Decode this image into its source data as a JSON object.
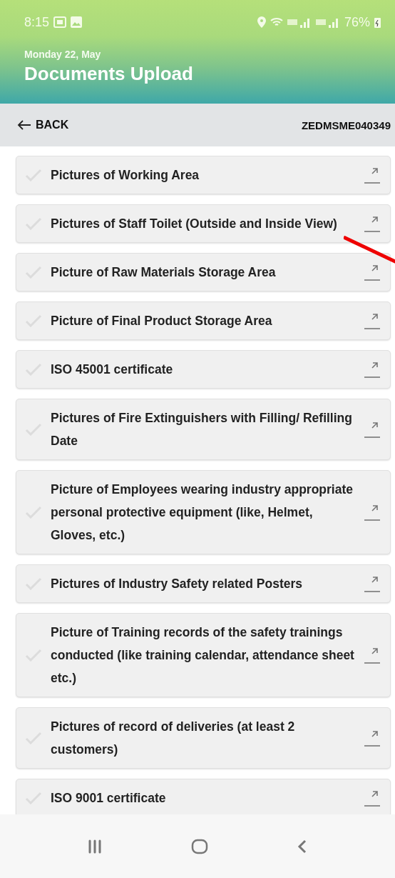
{
  "status_bar": {
    "time": "8:15",
    "battery": "76%"
  },
  "header": {
    "date": "Monday 22, May",
    "title": "Documents Upload"
  },
  "nav": {
    "back": "BACK",
    "code": "ZEDMSME040349"
  },
  "documents": [
    {
      "label": "Pictures of Working Area",
      "uploaded": false
    },
    {
      "label": "Pictures of Staff Toilet (Outside and Inside View)",
      "uploaded": false
    },
    {
      "label": "Picture of Raw Materials Storage Area",
      "uploaded": false
    },
    {
      "label": "Picture of Final Product Storage Area",
      "uploaded": false
    },
    {
      "label": "ISO 45001 certificate",
      "uploaded": false
    },
    {
      "label": "Pictures of Fire Extinguishers with Filling/ Refilling Date",
      "uploaded": false
    },
    {
      "label": "Picture of Employees wearing industry appropriate personal protective equipment (like, Helmet, Gloves, etc.)",
      "uploaded": false
    },
    {
      "label": "Pictures of Industry Safety related Posters",
      "uploaded": false
    },
    {
      "label": "Picture of Training records of the safety trainings conducted (like training calendar, attendance sheet etc.)",
      "uploaded": false
    },
    {
      "label": "Pictures of record of deliveries (at least 2 customers)",
      "uploaded": false
    },
    {
      "label": "ISO 9001 certificate",
      "uploaded": false
    }
  ]
}
